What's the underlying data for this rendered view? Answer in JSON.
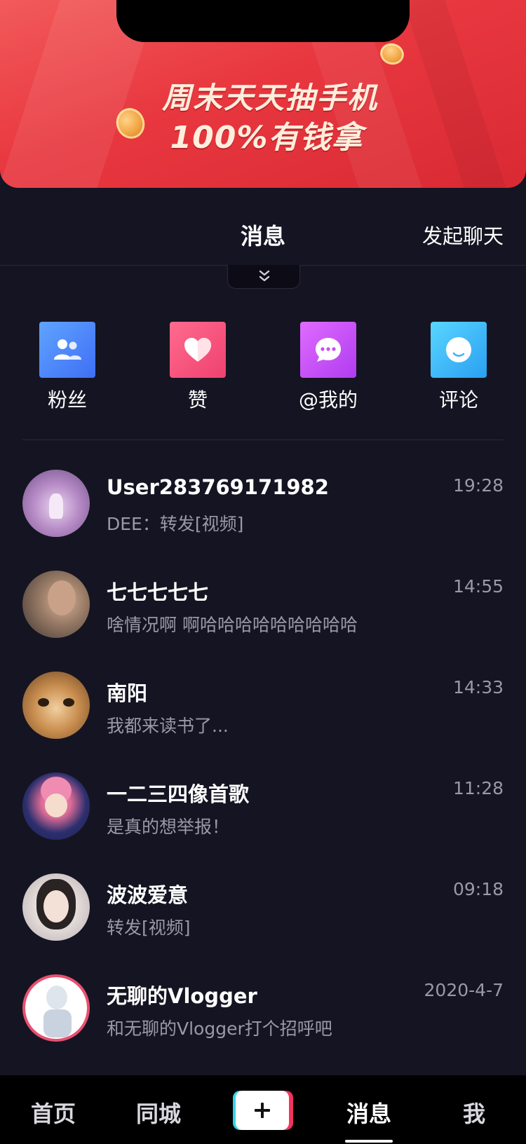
{
  "banner": {
    "line1": "周末天天抽手机",
    "line2": "100%有钱拿"
  },
  "header": {
    "title": "消息",
    "start_chat": "发起聊天"
  },
  "quick_entries": [
    {
      "label": "粉丝",
      "icon": "fans-icon",
      "color": "#4a82fb"
    },
    {
      "label": "赞",
      "icon": "heart-icon",
      "color": "#f25580"
    },
    {
      "label": "@我的",
      "icon": "chat-bubble-icon",
      "color": "#c84cf6"
    },
    {
      "label": "评论",
      "icon": "comment-icon",
      "color": "#3bb4f6"
    }
  ],
  "messages": [
    {
      "name": "User283769171982",
      "preview": "DEE：转发[视频]",
      "time": "19:28"
    },
    {
      "name": "七七七七七",
      "preview": "啥情况啊 啊哈哈哈哈哈哈哈哈哈",
      "time": "14:55"
    },
    {
      "name": "南阳",
      "preview": "我都来读书了...",
      "time": "14:33"
    },
    {
      "name": "一二三四像首歌",
      "preview": "是真的想举报！",
      "time": "11:28"
    },
    {
      "name": "波波爱意",
      "preview": "转发[视频]",
      "time": "09:18"
    },
    {
      "name": "无聊的Vlogger",
      "preview": "和无聊的Vlogger打个招呼吧",
      "time": "2020-4-7"
    }
  ],
  "tabbar": {
    "home": "首页",
    "city": "同城",
    "create": "+",
    "messages": "消息",
    "me": "我",
    "active": "messages"
  },
  "colors": {
    "background": "#151422",
    "banner_red": "#e8373f",
    "text_primary": "#ffffff",
    "text_secondary": "#9a99a6",
    "plus_cyan": "#37d3e6",
    "plus_pink": "#f2335f"
  }
}
